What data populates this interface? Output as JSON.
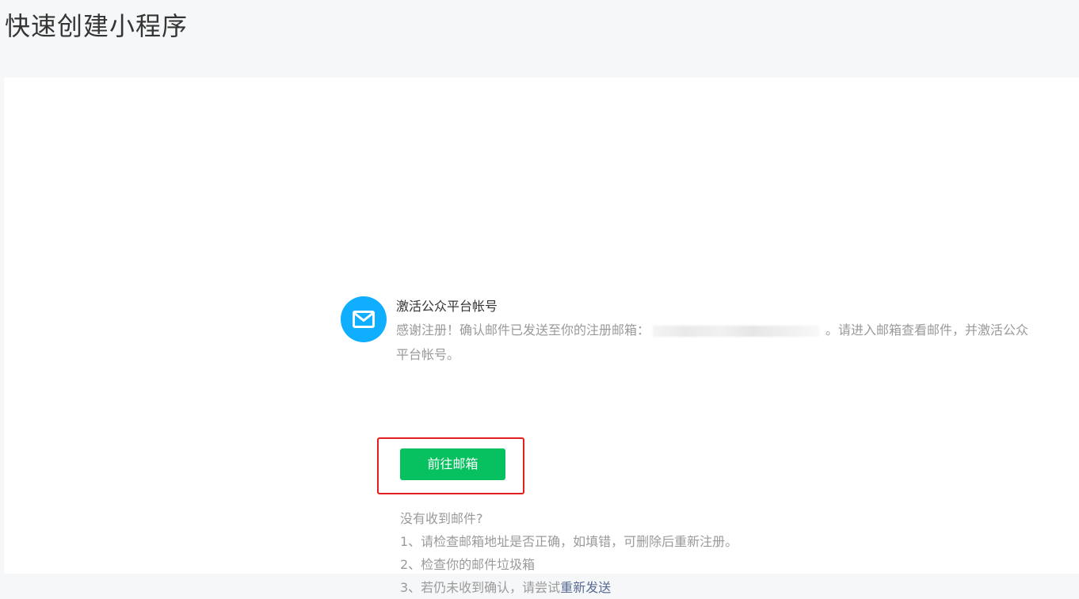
{
  "page": {
    "title": "快速创建小程序"
  },
  "activation": {
    "icon": "mail-icon",
    "title": "激活公众平台帐号",
    "desc_prefix": "感谢注册！确认邮件已发送至你的注册邮箱：",
    "desc_suffix": "。请进入邮箱查看邮件，并激活公众平台帐号。",
    "button_label": "前往邮箱"
  },
  "help": {
    "heading": "没有收到邮件?",
    "item1": "1、请检查邮箱地址是否正确，如填错，可删除后重新注册。",
    "item2": "2、检查你的邮件垃圾箱",
    "item3_prefix": "3、若仍未收到确认，请尝试",
    "item3_link": "重新发送"
  },
  "colors": {
    "primary_button": "#07c160",
    "icon_bg": "#10aeff",
    "link": "#576b95",
    "highlight_border": "#e41e1e"
  }
}
